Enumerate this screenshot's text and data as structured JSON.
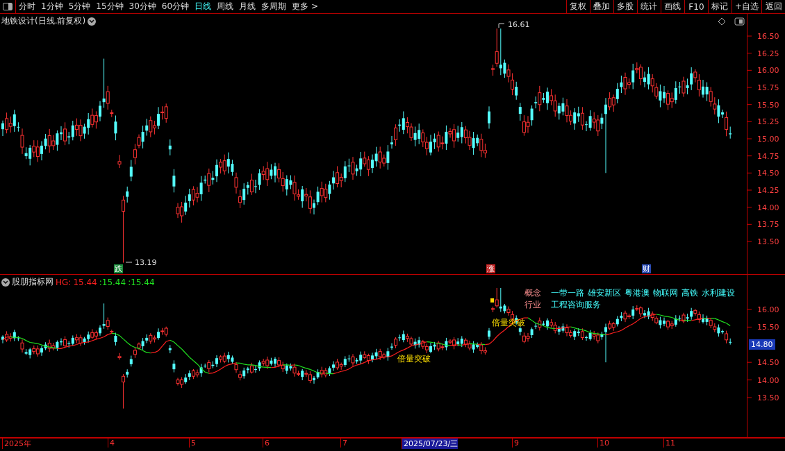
{
  "toolbar": {
    "periods": [
      {
        "label": "分时",
        "selected": false
      },
      {
        "label": "1分钟",
        "selected": false
      },
      {
        "label": "5分钟",
        "selected": false
      },
      {
        "label": "15分钟",
        "selected": false
      },
      {
        "label": "30分钟",
        "selected": false
      },
      {
        "label": "60分钟",
        "selected": false
      },
      {
        "label": "日线",
        "selected": true
      },
      {
        "label": "周线",
        "selected": false
      },
      {
        "label": "月线",
        "selected": false
      },
      {
        "label": "多周期",
        "selected": false
      },
      {
        "label": "更多 >",
        "selected": false
      }
    ],
    "buttons": [
      "复权",
      "叠加",
      "多股",
      "统计",
      "画线",
      "F10",
      "标记",
      "+自选",
      "返回"
    ]
  },
  "main_chart": {
    "title": "地铁设计(日线.前复权)",
    "high_label": "16.61",
    "low_label": "13.19",
    "y_ticks": [
      "16.50",
      "16.25",
      "16.00",
      "15.75",
      "15.50",
      "15.25",
      "15.00",
      "14.75",
      "14.50",
      "14.25",
      "14.00",
      "13.75",
      "13.50"
    ],
    "events": [
      {
        "label": "跌",
        "color": "#1a8a3a"
      },
      {
        "label": "涨",
        "color": "#c02020"
      },
      {
        "label": "财",
        "color": "#2a4ab0"
      }
    ]
  },
  "indicator": {
    "title": "股朋指标网",
    "hg_label": "HG:",
    "hg_value": "15.44",
    "values": [
      ":15.44",
      ":15.44"
    ],
    "signals": [
      "倍量突破",
      "倍量突破"
    ],
    "concept_label": "概念",
    "industry_label": "行业",
    "concepts": [
      "一带一路",
      "雄安新区",
      "粤港澳",
      "物联网",
      "高铁",
      "水利建设"
    ],
    "industry": "工程咨询服务",
    "y_ticks": [
      "16.00",
      "15.50",
      "14.50",
      "14.00",
      "13.50"
    ],
    "price_box": "14.80"
  },
  "time_axis": [
    {
      "label": "2025年",
      "selected": false
    },
    {
      "label": "4",
      "selected": false
    },
    {
      "label": "5",
      "selected": false
    },
    {
      "label": "6",
      "selected": false
    },
    {
      "label": "7",
      "selected": false
    },
    {
      "label": "2025/07/23/三",
      "selected": true
    },
    {
      "label": "9",
      "selected": false
    },
    {
      "label": "10",
      "selected": false
    },
    {
      "label": "11",
      "selected": false
    }
  ]
}
